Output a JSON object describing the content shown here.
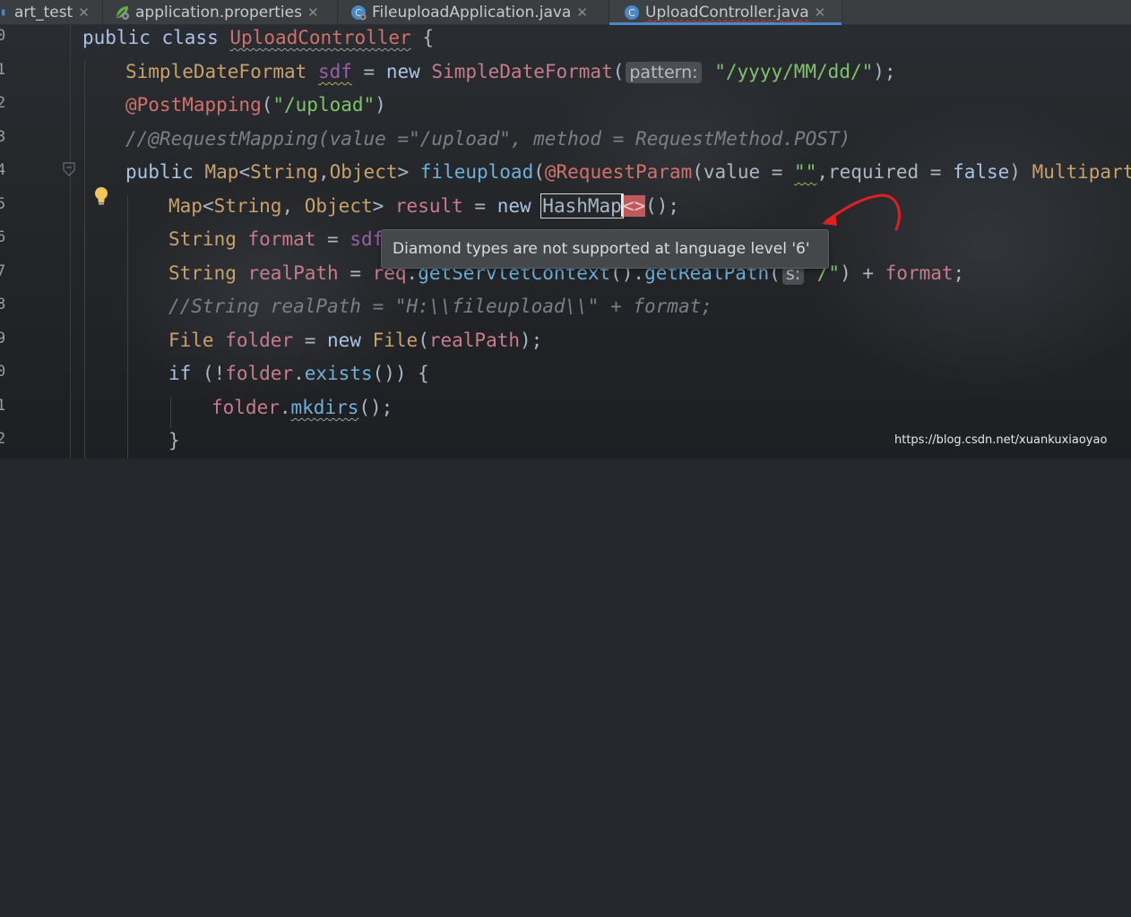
{
  "tabs": [
    {
      "label": "art_test",
      "icon": "module-icon",
      "active": false
    },
    {
      "label": "application.properties",
      "icon": "spring-leaf-icon",
      "active": false
    },
    {
      "label": "FileuploadApplication.java",
      "icon": "spring-app-class-icon",
      "active": false
    },
    {
      "label": "UploadController.java",
      "icon": "class-icon",
      "active": true
    }
  ],
  "close_glyph": "✕",
  "gutter": {
    "line_numbers": [
      "0",
      "1",
      "2",
      "3",
      "4",
      "5",
      "6",
      "7",
      "8",
      "9",
      "0",
      "1",
      "2"
    ]
  },
  "code": {
    "l0": [
      "public",
      " ",
      "class",
      " ",
      "UploadController",
      " {"
    ],
    "l1": [
      "SimpleDateFormat",
      " ",
      "sdf",
      " = ",
      "new",
      " ",
      "SimpleDateFormat",
      "(",
      "pattern:",
      " ",
      "\"/yyyy/MM/dd/\"",
      ");"
    ],
    "l2": [
      "@PostMapping",
      "(",
      "\"/upload\"",
      ")"
    ],
    "l3": [
      "//@RequestMapping(value =\"/upload\", method = RequestMethod.POST)"
    ],
    "l4": [
      "public",
      " ",
      "Map",
      "<",
      "String",
      ",",
      "Object",
      "> ",
      "fileupload",
      "(",
      "@RequestParam",
      "(value = ",
      "\"\"",
      ",required = ",
      "false",
      ") ",
      "MultipartFile"
    ],
    "l5": [
      "Map",
      "<",
      "String",
      ", ",
      "Object",
      "> ",
      "result",
      " = ",
      "new",
      " ",
      "HashMap",
      "<>",
      "();"
    ],
    "l6": [
      "String",
      " ",
      "format",
      " = ",
      "sdf"
    ],
    "l7": [
      "String",
      " ",
      "realPath",
      " = ",
      "req",
      ".",
      "getServletContext",
      "().",
      "getRealPath",
      "(",
      "s:",
      " ",
      "/\"",
      ") + ",
      "format",
      ";"
    ],
    "l8": [
      "//String realPath = \"H:\\\\fileupload\\\\\" + format;"
    ],
    "l9": [
      "File",
      " ",
      "folder",
      " = ",
      "new",
      " ",
      "File",
      "(",
      "realPath",
      ");"
    ],
    "l10": [
      "if",
      " (!",
      "folder",
      ".",
      "exists",
      "()) {"
    ],
    "l11": [
      "folder",
      ".",
      "mkdirs",
      "();"
    ],
    "l12": [
      "}"
    ]
  },
  "tooltip": {
    "text": "Diamond types are not supported at language level '6'"
  },
  "annotation": {
    "arrow_color": "#e02020"
  },
  "watermark": {
    "text": "https://blog.csdn.net/xuankuxiaoyao"
  },
  "colors": {
    "keyword": "#a9c3e6",
    "type": "#c8a26a",
    "field": "#c77c8c",
    "string": "#7fc36d",
    "annotation": "#d2716c",
    "comment": "#7b8088",
    "method": "#6fb0d9",
    "error_highlight": "#c0595c",
    "tab_underline": "#4a88c7"
  }
}
